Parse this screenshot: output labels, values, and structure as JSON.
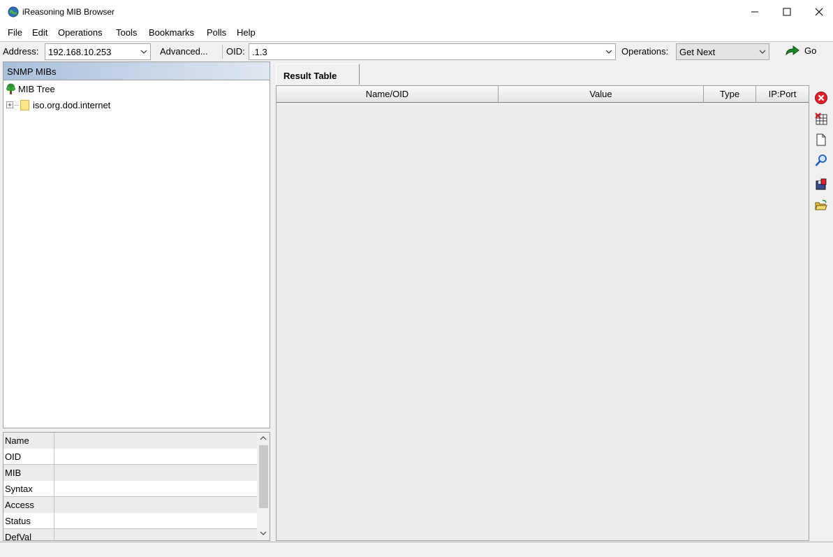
{
  "window": {
    "title": "iReasoning MIB Browser",
    "minimize_icon": "minimize-icon",
    "maximize_icon": "maximize-icon",
    "close_icon": "close-icon"
  },
  "menu": [
    "File",
    "Edit",
    "Operations",
    "Tools",
    "Bookmarks",
    "Polls",
    "Help"
  ],
  "toolbar": {
    "address_label": "Address:",
    "address_value": "192.168.10.253",
    "advanced_label": "Advanced...",
    "oid_label": "OID:",
    "oid_value": ".1.3",
    "operations_label": "Operations:",
    "operations_value": "Get Next",
    "go_label": "Go"
  },
  "mib_panel": {
    "header": "SNMP MIBs",
    "tree": [
      {
        "label": "MIB Tree",
        "icon": "tree-icon"
      },
      {
        "label": "iso.org.dod.internet",
        "icon": "folder-icon"
      }
    ]
  },
  "properties": [
    {
      "name": "Name",
      "value": ""
    },
    {
      "name": "OID",
      "value": ""
    },
    {
      "name": "MIB",
      "value": ""
    },
    {
      "name": "Syntax",
      "value": ""
    },
    {
      "name": "Access",
      "value": ""
    },
    {
      "name": "Status",
      "value": ""
    },
    {
      "name": "DefVal",
      "value": ""
    }
  ],
  "result": {
    "tab_label": "Result Table",
    "columns": [
      "Name/OID",
      "Value",
      "Type",
      "IP:Port"
    ]
  },
  "side_tools": [
    "stop-icon",
    "clear-table-icon",
    "new-document-icon",
    "find-icon",
    "save-icon",
    "open-folder-icon"
  ],
  "colors": {
    "header_gradient_start": "#a9c0dc",
    "stop_red": "#e0242a",
    "go_green": "#1a8a2a"
  }
}
